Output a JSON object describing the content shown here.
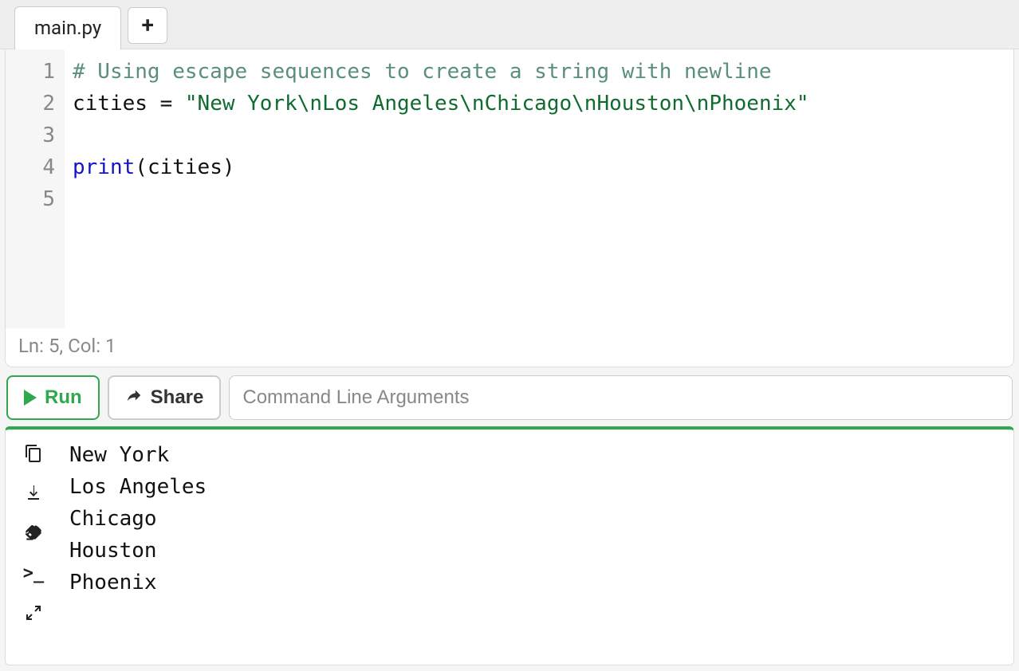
{
  "tabs": {
    "active": "main.py"
  },
  "code": {
    "lines": [
      {
        "num": "1",
        "tokens": [
          {
            "cls": "tok-comment",
            "t": "# Using escape sequences to create a string with newline"
          }
        ]
      },
      {
        "num": "2",
        "tokens": [
          {
            "cls": "tok-name",
            "t": "cities "
          },
          {
            "cls": "tok-op",
            "t": "= "
          },
          {
            "cls": "tok-string",
            "t": "\"New York\\nLos Angeles\\nChicago\\nHouston\\nPhoenix\""
          }
        ]
      },
      {
        "num": "3",
        "tokens": []
      },
      {
        "num": "4",
        "tokens": [
          {
            "cls": "tok-builtin",
            "t": "print"
          },
          {
            "cls": "tok-paren",
            "t": "("
          },
          {
            "cls": "tok-name",
            "t": "cities"
          },
          {
            "cls": "tok-paren",
            "t": ")"
          }
        ]
      },
      {
        "num": "5",
        "tokens": []
      }
    ]
  },
  "status": {
    "text": "Ln: 5,  Col: 1"
  },
  "toolbar": {
    "run_label": "Run",
    "share_label": "Share",
    "args_placeholder": "Command Line Arguments"
  },
  "output": {
    "lines": [
      "New York",
      "Los Angeles",
      "Chicago",
      "Houston",
      "Phoenix"
    ]
  }
}
